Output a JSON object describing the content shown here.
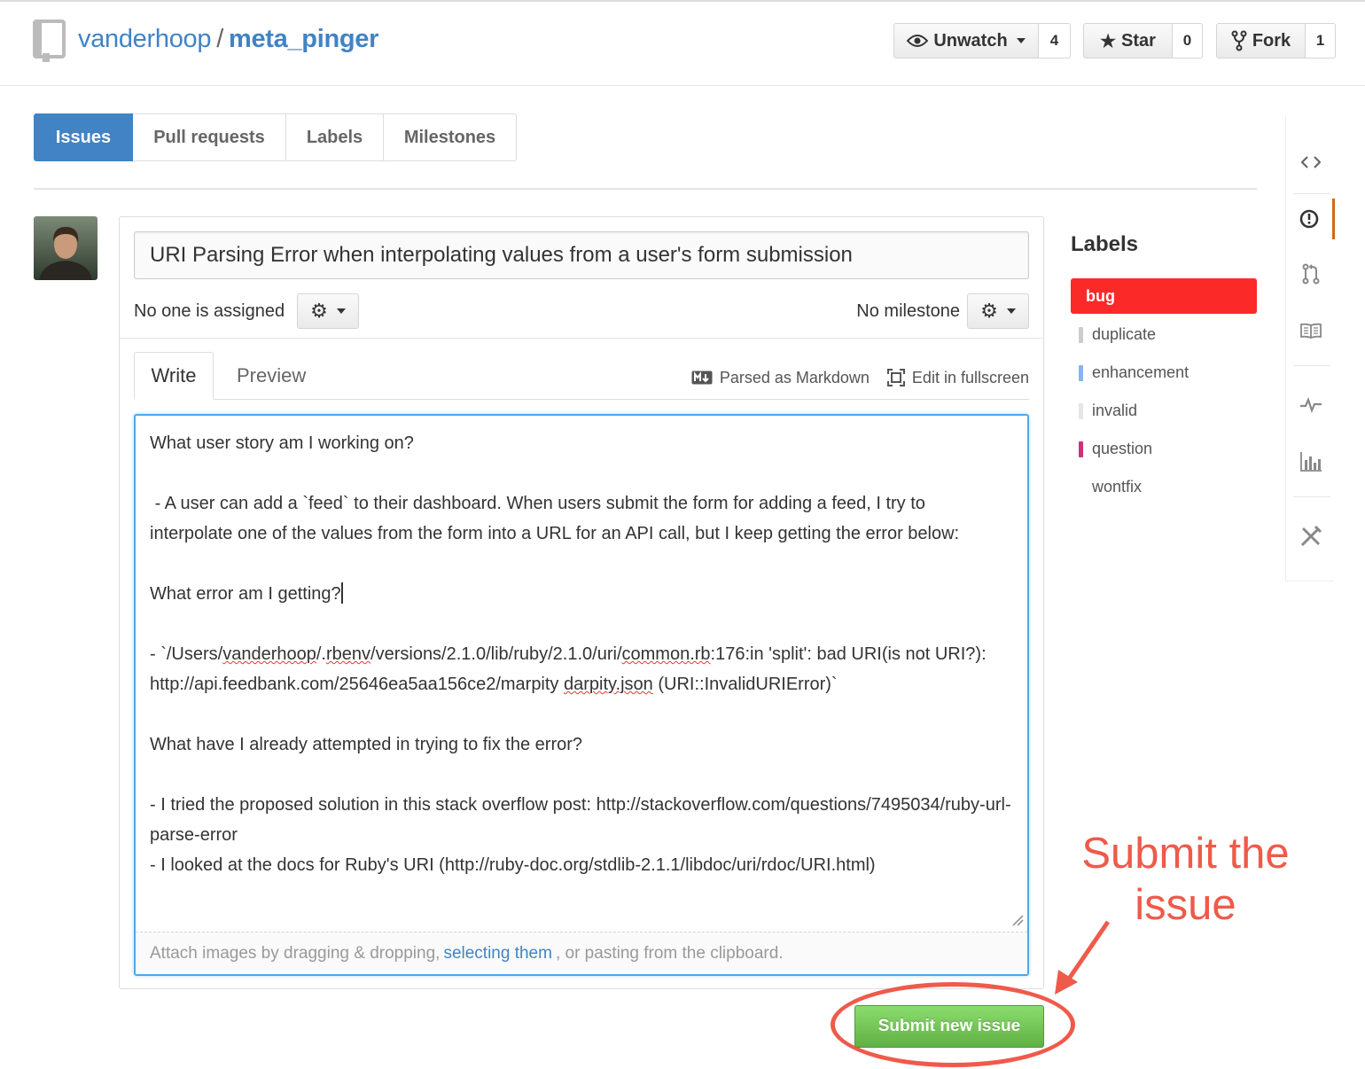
{
  "header": {
    "owner": "vanderhoop",
    "separator": "/",
    "repo": "meta_pinger",
    "watch": {
      "label": "Unwatch",
      "count": "4"
    },
    "star": {
      "label": "Star",
      "count": "0"
    },
    "fork": {
      "label": "Fork",
      "count": "1"
    }
  },
  "subnav": {
    "tabs": [
      {
        "label": "Issues",
        "selected": true
      },
      {
        "label": "Pull requests"
      },
      {
        "label": "Labels"
      },
      {
        "label": "Milestones"
      }
    ]
  },
  "issue_form": {
    "title_value": "URI Parsing Error when interpolating values from a user's form submission",
    "assignee_text": "No one is assigned",
    "milestone_text": "No milestone",
    "tabs": {
      "write": "Write",
      "preview": "Preview"
    },
    "markdown_note": "Parsed as Markdown",
    "fullscreen": "Edit in fullscreen",
    "body": {
      "line1": "What user story am I working on?",
      "line2": " - A user can add a `feed` to their dashboard. When users submit the form for adding a feed, I try to interpolate one of the values from the form into a URL for an API call, but I keep getting the error below:",
      "line3": "What error am I getting?",
      "line4_prefix": "- `/Users/",
      "line4_w1": "vanderhoop",
      "line4_mid1": "/.",
      "line4_w2": "rbenv",
      "line4_mid2": "/versions/2.1.0/lib/ruby/2.1.0/uri/",
      "line4_w3": "common.rb",
      "line4_mid3": ":176:in 'split': bad URI(is not URI?): http://api.feedbank.com/25646ea5aa156ce2/marpity ",
      "line4_w4": "darpity.json",
      "line4_suffix": " (URI::InvalidURIError)`",
      "line5": "What have I already attempted in trying to fix the error?",
      "line6": "- I tried the proposed solution in this stack overflow post: http://stackoverflow.com/questions/7495034/ruby-url-parse-error",
      "line7": "- I looked at the docs for Ruby's URI (http://ruby-doc.org/stdlib-2.1.1/libdoc/uri/rdoc/URI.html)"
    },
    "attach": {
      "before": "Attach images by dragging & dropping,",
      "link": "selecting them",
      "after": ", or pasting from the clipboard."
    },
    "submit_label": "Submit new issue"
  },
  "labels": {
    "title": "Labels",
    "items": [
      {
        "name": "bug",
        "color": "#fc2929",
        "selected": true
      },
      {
        "name": "duplicate",
        "color": "#cccccc"
      },
      {
        "name": "enhancement",
        "color": "#84b6eb"
      },
      {
        "name": "invalid",
        "color": "#e6e6e6"
      },
      {
        "name": "question",
        "color": "#cc317c"
      },
      {
        "name": "wontfix",
        "color": "#ffffff"
      }
    ]
  },
  "repo_nav_icons": [
    "code-icon",
    "issues-icon",
    "pull-request-icon",
    "wiki-icon",
    "pulse-icon",
    "graphs-icon",
    "settings-icon"
  ],
  "annotation": {
    "line1": "Submit the",
    "line2": "issue",
    "color": "#ef5a4a"
  },
  "colors": {
    "accent": "#4183c4",
    "bug": "#fc2929",
    "submit_green": "#60b044",
    "focus_blue": "#51a7e8"
  }
}
